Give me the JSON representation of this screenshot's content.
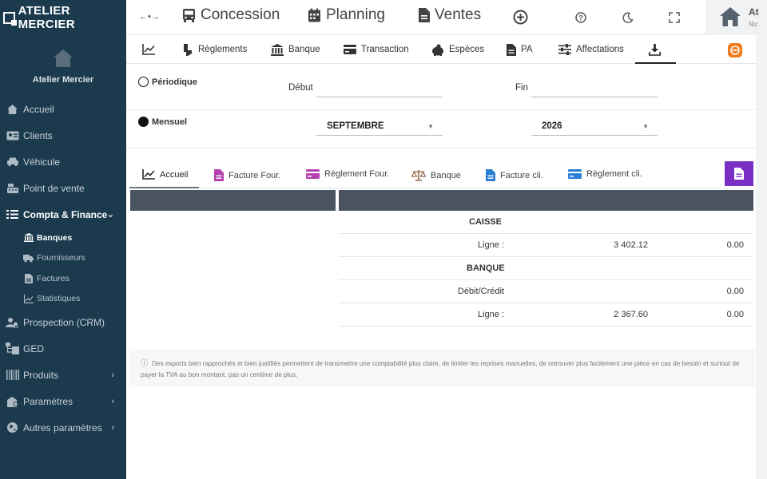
{
  "brand": {
    "name": "ATELIER MERCIER"
  },
  "profile": {
    "name": "Atelier Mercier"
  },
  "sidebar": {
    "items": [
      {
        "label": "Accueil",
        "icon": "home-icon"
      },
      {
        "label": "Clients",
        "icon": "id-card-icon"
      },
      {
        "label": "Véhicule",
        "icon": "car-icon"
      },
      {
        "label": "Point de vente",
        "icon": "cash-register-icon"
      },
      {
        "label": "Compta & Finance",
        "icon": "list-icon",
        "expanded": true
      },
      {
        "label": "Prospection (CRM)",
        "icon": "users-icon"
      },
      {
        "label": "GED",
        "icon": "folder-tree-icon"
      },
      {
        "label": "Produits",
        "icon": "barcode-icon"
      },
      {
        "label": "Paramètres",
        "icon": "user-gear-icon"
      },
      {
        "label": "Autres paramètres",
        "icon": "globe-icon"
      }
    ],
    "subitems": [
      {
        "label": "Banques",
        "icon": "bank-icon",
        "active": true
      },
      {
        "label": "Fournisseurs",
        "icon": "truck-icon"
      },
      {
        "label": "Factures",
        "icon": "file-icon"
      },
      {
        "label": "Statistiques",
        "icon": "chart-line-icon"
      }
    ]
  },
  "topbar": {
    "nav": [
      {
        "label": "Concession",
        "icon": "bus-icon"
      },
      {
        "label": "Planning",
        "icon": "calendar-icon"
      },
      {
        "label": "Ventes",
        "icon": "file-icon"
      }
    ],
    "user_name": "At",
    "user_sub": "Nic"
  },
  "tabs": [
    {
      "label": "",
      "icon": "chart-line-icon"
    },
    {
      "label": "Règlements",
      "icon": "hand-coin-icon"
    },
    {
      "label": "Banque",
      "icon": "bank-icon"
    },
    {
      "label": "Transaction",
      "icon": "credit-card-icon"
    },
    {
      "label": "Espèces",
      "icon": "piggy-bank-icon"
    },
    {
      "label": "PA",
      "icon": "file-icon"
    },
    {
      "label": "Affectations",
      "icon": "sliders-icon"
    },
    {
      "label": "",
      "icon": "download-icon",
      "active": true
    }
  ],
  "form": {
    "periodique_label": "Périodique",
    "periodique_selected": false,
    "debut_label": "Début",
    "debut_value": "",
    "fin_label": "Fin",
    "fin_value": "",
    "mensuel_label": "Mensuel",
    "mensuel_selected": true,
    "month_value": "SEPTEMBRE",
    "year_value": "2026"
  },
  "subtabs": [
    {
      "label": "Accueil",
      "icon": "chart-line-icon",
      "color": "#222222",
      "active": true
    },
    {
      "label": "Facture Four.",
      "icon": "file-icon",
      "color": "#b43fae"
    },
    {
      "label": "Règlement Four.",
      "icon": "credit-card-icon",
      "color": "#b43fae"
    },
    {
      "label": "Banque",
      "icon": "scale-icon",
      "color": "#9a6b4b"
    },
    {
      "label": "Facture cli.",
      "icon": "file-icon",
      "color": "#2a7fd4"
    },
    {
      "label": "Règlement cli.",
      "icon": "credit-card-icon",
      "color": "#2a7fd4"
    }
  ],
  "table": {
    "rows": [
      {
        "type": "section",
        "label": "CAISSE"
      },
      {
        "type": "data",
        "label": "Ligne :",
        "col2": "3 402.12",
        "col3": "0.00"
      },
      {
        "type": "section",
        "label": "BANQUE"
      },
      {
        "type": "data",
        "label": "Débit/Crédit",
        "col2": "",
        "col3": "0.00"
      },
      {
        "type": "data",
        "label": "Ligne :",
        "col2": "2 367.60",
        "col3": "0.00"
      }
    ]
  },
  "note": {
    "text": "Des exports bien rapprochés et bien justifiés permettent de transmettre une comptabilité plus claire, de limiter les reprises manuelles, de retrouver plus facilement une pièce en cas de besoin et surtout de payer la TVA au bon montant, pas un centime de plus."
  },
  "colors": {
    "sidebar_bg": "#1b3a4e",
    "table_header": "#4a5362",
    "accent_orange": "#f07c1e",
    "accent_purple": "#7a2fc4"
  }
}
